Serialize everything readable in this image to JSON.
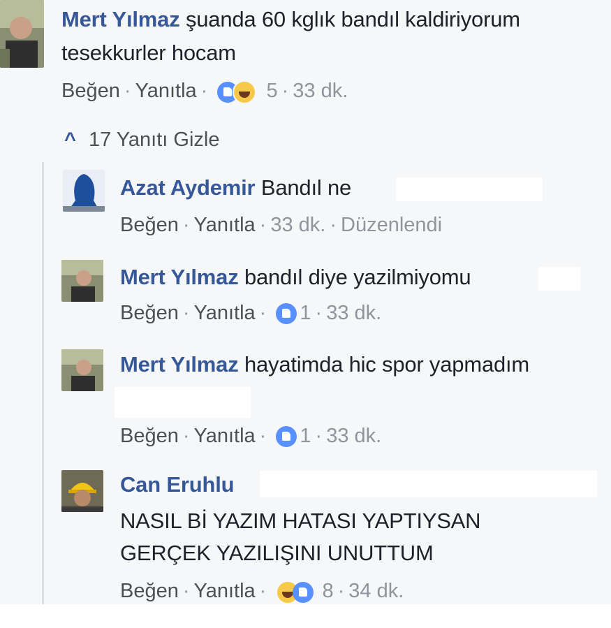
{
  "comments": [
    {
      "author": "Mert Yılmaz",
      "text_line1": "şuanda 60 kglık bandıl kaldiriyorum",
      "text_line2": "tesekkurler hocam",
      "like": "Beğen",
      "reply": "Yanıtla",
      "reaction_count": "5",
      "time": "33 dk."
    }
  ],
  "toggle": {
    "label": "17 Yanıtı Gizle",
    "chevron": "^"
  },
  "replies": [
    {
      "author": "Azat Aydemir",
      "text": "Bandıl ne",
      "like": "Beğen",
      "reply": "Yanıtla",
      "time": "33 dk.",
      "edited": "Düzenlendi"
    },
    {
      "author": "Mert Yılmaz",
      "text": "bandıl diye yazilmiyomu",
      "like": "Beğen",
      "reply": "Yanıtla",
      "reaction_count": "1",
      "time": "33 dk."
    },
    {
      "author": "Mert Yılmaz",
      "text": "hayatimda hic spor yapmadım",
      "like": "Beğen",
      "reply": "Yanıtla",
      "reaction_count": "1",
      "time": "33 dk."
    },
    {
      "author": "Can Eruhlu",
      "text_line1": "NASIL Bİ YAZIM HATASI YAPTIYSAN",
      "text_line2": "GERÇEK YAZILIŞINI UNUTTUM",
      "like": "Beğen",
      "reply": "Yanıtla",
      "reaction_count": "8",
      "time": "34 dk."
    }
  ],
  "colors": {
    "name": "#365899",
    "like_blue": "#5890ff",
    "meta_gray": "#90949c",
    "panel_bg": "#f6f7f9"
  }
}
